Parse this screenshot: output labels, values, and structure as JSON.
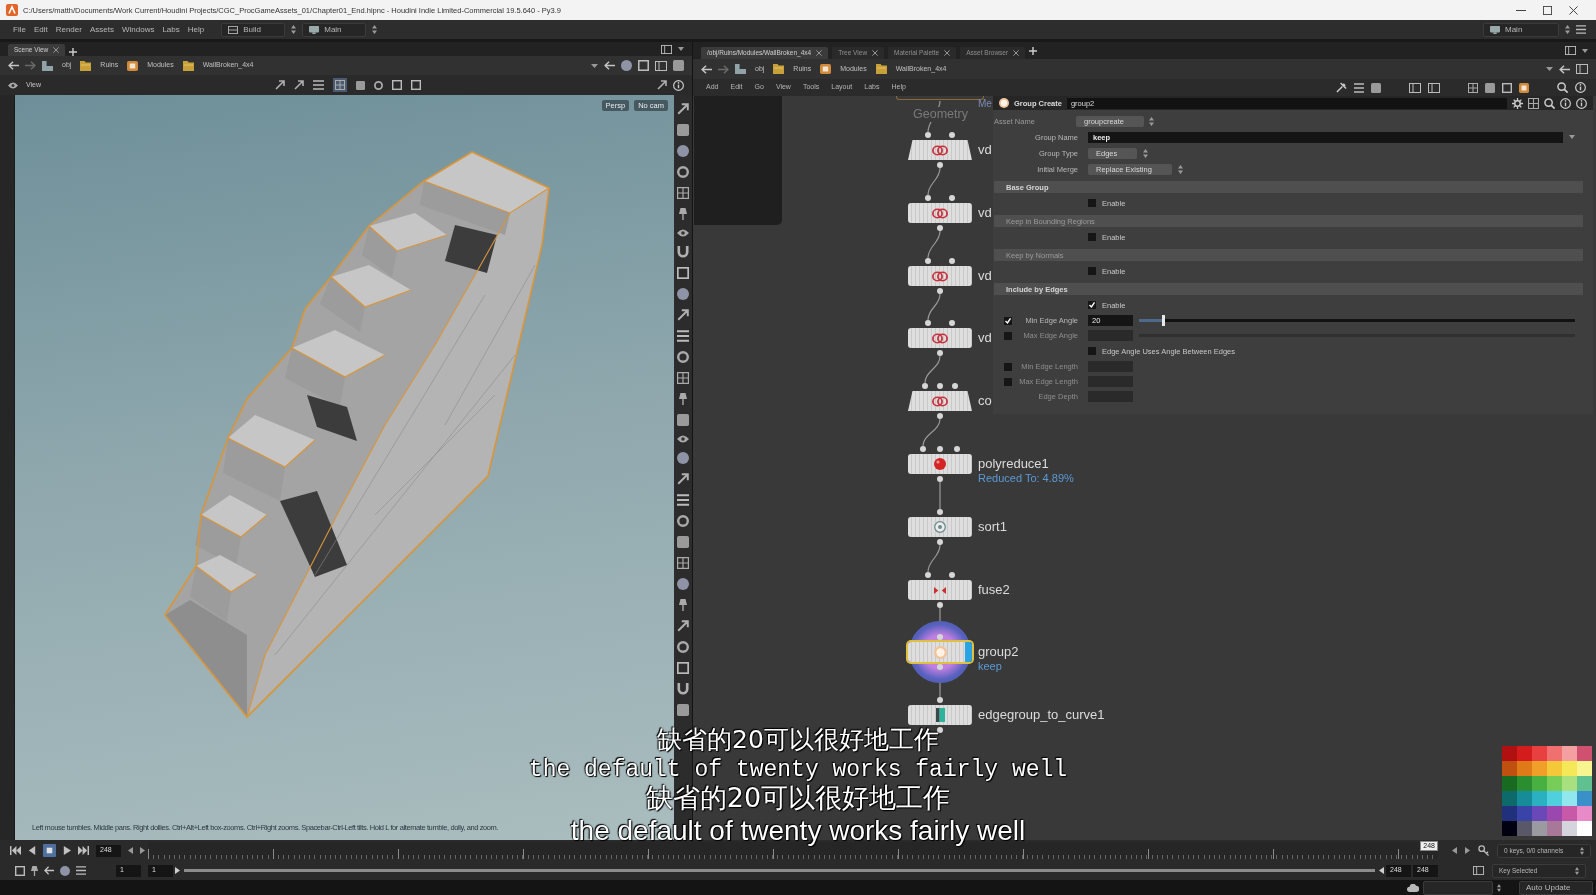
{
  "window": {
    "title": "C:/Users/matth/Documents/Work Current/Houdini Projects/CGC_ProcGameAssets_01/Chapter01_End.hipnc - Houdini Indie Limited-Commercial 19.5.640 - Py3.9"
  },
  "main_menu": {
    "items": [
      "File",
      "Edit",
      "Render",
      "Assets",
      "Windows",
      "Labs",
      "Help"
    ],
    "shelf_set": "Build",
    "desktop": "Main",
    "desktop_right": "Main"
  },
  "scene_view": {
    "tabs": [
      {
        "label": "Scene View",
        "selected": true
      }
    ],
    "path": [
      "obj",
      "Ruins",
      "Modules",
      "WallBroken_4x4"
    ],
    "toolbar_label": "View",
    "camera_menus": [
      "Persp",
      "No cam"
    ],
    "hint": "Left mouse tumbles. Middle pans. Right dollies. Ctrl+Alt+Left box-zooms. Ctrl+Right zooms. Spacebar-Ctrl-Left tilts. Hold L for alternate tumble, dolly, and zoom."
  },
  "network_view": {
    "tabs": [
      {
        "label": "/obj/Ruins/Modules/WallBroken_4x4",
        "selected": true
      },
      {
        "label": "Tree View",
        "selected": false
      },
      {
        "label": "Material Palette",
        "selected": false
      },
      {
        "label": "Asset Browser",
        "selected": false
      }
    ],
    "path": [
      "obj",
      "Ruins",
      "Modules",
      "WallBroken_4x4"
    ],
    "menu": [
      "Add",
      "Edit",
      "Go",
      "View",
      "Tools",
      "Layout",
      "Labs",
      "Help"
    ],
    "context_labels": [
      "Geometry",
      "Me"
    ],
    "nodes": [
      {
        "name": "vd",
        "kind": "subnet",
        "selected": false,
        "display": false
      },
      {
        "name": "vd",
        "kind": "asset",
        "selected": false,
        "display": false
      },
      {
        "name": "vd",
        "kind": "asset",
        "selected": false,
        "display": false
      },
      {
        "name": "vd",
        "kind": "asset",
        "selected": false,
        "display": false
      },
      {
        "name": "co",
        "kind": "multisubnet",
        "selected": false,
        "display": false
      },
      {
        "name": "polyreduce1",
        "kind": "reduce",
        "selected": false,
        "display": false,
        "note": "Reduced To: 4.89%"
      },
      {
        "name": "sort1",
        "kind": "sort",
        "selected": false,
        "display": false
      },
      {
        "name": "fuse2",
        "kind": "fuse",
        "selected": false,
        "display": false
      },
      {
        "name": "group2",
        "kind": "group",
        "selected": true,
        "display": true,
        "note": "keep"
      },
      {
        "name": "edgegroup_to_curve1",
        "kind": "curve",
        "selected": false,
        "display": false
      }
    ],
    "palette": [
      {
        "color": "#b01010"
      },
      {
        "color": "#d41c1c"
      },
      {
        "color": "#e84040"
      },
      {
        "color": "#f07070"
      },
      {
        "color": "#f4a0a0"
      },
      {
        "color": "#d05070"
      },
      {
        "color": "#c05010"
      },
      {
        "color": "#e07a18"
      },
      {
        "color": "#f0a028"
      },
      {
        "color": "#f4c838"
      },
      {
        "color": "#f4e858"
      },
      {
        "color": "#f8f490"
      },
      {
        "color": "#186a20"
      },
      {
        "color": "#2a8e30"
      },
      {
        "color": "#48b040"
      },
      {
        "color": "#78cc58"
      },
      {
        "color": "#a8e080"
      },
      {
        "color": "#60c090"
      },
      {
        "color": "#0e6a6a"
      },
      {
        "color": "#168c98"
      },
      {
        "color": "#2ab0c0"
      },
      {
        "color": "#50d0dc"
      },
      {
        "color": "#90e8ee"
      },
      {
        "color": "#3a90c8"
      },
      {
        "color": "#20307a"
      },
      {
        "color": "#3a44a8"
      },
      {
        "color": "#6a48b8"
      },
      {
        "color": "#9a48b0"
      },
      {
        "color": "#c858a8"
      },
      {
        "color": "#e88ac8"
      },
      {
        "color": "#000010"
      },
      {
        "color": "#585868"
      },
      {
        "color": "#9a9aa0"
      },
      {
        "color": "#a87898"
      },
      {
        "color": "#d4d4dc"
      },
      {
        "color": "#ffffff"
      }
    ]
  },
  "parameters": {
    "node_type": "Group Create",
    "node_name": "group2",
    "rows": [
      {
        "kind": "assetmenu",
        "label": "Asset Name",
        "value": "groupcreate"
      },
      {
        "kind": "text",
        "label": "Group Name",
        "value": "keep"
      },
      {
        "kind": "menu",
        "label": "Group Type",
        "value": "Edges"
      },
      {
        "kind": "menu",
        "label": "Initial Merge",
        "value": "Replace Existing"
      },
      {
        "kind": "section",
        "label": "Base Group",
        "emphasized": true
      },
      {
        "kind": "toggle",
        "label": "Enable",
        "checked": false
      },
      {
        "kind": "section",
        "label": "Keep in Bounding Regions",
        "emphasized": false
      },
      {
        "kind": "toggle",
        "label": "Enable",
        "checked": false
      },
      {
        "kind": "section",
        "label": "Keep by Normals",
        "emphasized": false
      },
      {
        "kind": "toggle",
        "label": "Enable",
        "checked": false
      },
      {
        "kind": "section",
        "label": "Include by Edges",
        "emphasized": true
      },
      {
        "kind": "toggle",
        "label": "Enable",
        "checked": true
      },
      {
        "kind": "slider",
        "label": "Min Edge Angle",
        "checked": true,
        "disabled": false,
        "value": "20",
        "level": 0.056
      },
      {
        "kind": "slider",
        "label": "Max Edge Angle",
        "checked": false,
        "disabled": true
      },
      {
        "kind": "toggle",
        "label": "Edge Angle Uses Angle Between Edges",
        "checked": false
      },
      {
        "kind": "field",
        "label": "Min Edge Length",
        "checked": false,
        "disabled": true
      },
      {
        "kind": "field",
        "label": "Max Edge Length",
        "checked": false,
        "disabled": true
      },
      {
        "kind": "field",
        "label": "Edge Depth",
        "disabled": true
      }
    ]
  },
  "playbar": {
    "frame": "248",
    "marker": "248",
    "start": [
      "1",
      "1"
    ],
    "end": [
      "248",
      "248"
    ],
    "key_info": "0 keys, 0/0 channels",
    "key_mode": "Key Selected"
  },
  "status_bar": {
    "update_mode": "Auto Update"
  },
  "subtitles": [
    {
      "kind": "cjk",
      "text": "缺省的20可以很好地工作"
    },
    {
      "kind": "mono",
      "text": "the default of twenty works fairly well"
    },
    {
      "kind": "cjklarge",
      "text": "缺省的20可以很好地工作"
    },
    {
      "kind": "sans",
      "text": "the default of twenty works fairly well"
    }
  ]
}
